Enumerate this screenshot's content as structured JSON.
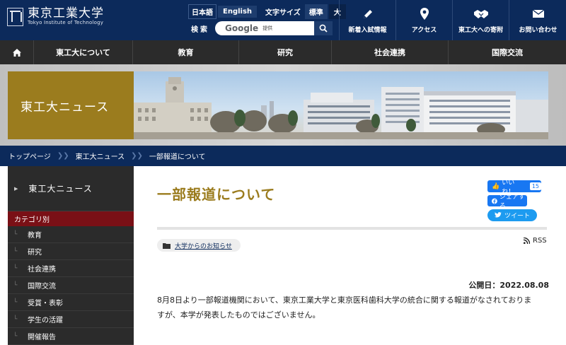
{
  "header": {
    "logo_jp": "東京工業大学",
    "logo_en": "Tokyo Institute of Technology",
    "lang_jp": "日本語",
    "lang_en": "English",
    "font_size_label": "文字サイズ",
    "font_size_standard": "標準",
    "font_size_large": "大",
    "search_label": "検索",
    "search_provider": "Google",
    "search_provider_sub": "提供",
    "util_nav": [
      {
        "label": "新着入試情報",
        "icon": "pencil-icon"
      },
      {
        "label": "アクセス",
        "icon": "map-pin-icon"
      },
      {
        "label": "東工大への寄附",
        "icon": "handshake-icon"
      },
      {
        "label": "お問い合わせ",
        "icon": "mail-icon"
      }
    ]
  },
  "gnav": {
    "items": [
      "東工大について",
      "教育",
      "研究",
      "社会連携",
      "国際交流"
    ]
  },
  "banner": {
    "title": "東工大ニュース"
  },
  "breadcrumb": [
    "トップページ",
    "東工大ニュース",
    "一部報道について"
  ],
  "sidebar": {
    "heading": "東工大ニュース",
    "category_label": "カテゴリ別",
    "items": [
      "教育",
      "研究",
      "社会連携",
      "国際交流",
      "受賞・表彰",
      "学生の活躍",
      "開催報告"
    ]
  },
  "article": {
    "title": "一部報道について",
    "category_tag": "大学からのお知らせ",
    "rss_label": "RSS",
    "published": "公開日：2022.08.08",
    "body_line1": "8月8日より一部報道機関において、東京工業大学と東京医科歯科大学の統合に関する報道がなされておりま",
    "body_line2": "すが、本学が発表したものではございません。"
  },
  "social": {
    "like_label": "いいね！",
    "like_count": "15",
    "share_label": "シェアする",
    "tweet_label": "ツイート"
  },
  "colors": {
    "navy": "#0c2a5b",
    "gold": "#9b7c1e",
    "dark_nav": "#2b2b2b",
    "category_red": "#7a1016",
    "facebook": "#1877f2",
    "twitter": "#1d9bf0"
  }
}
